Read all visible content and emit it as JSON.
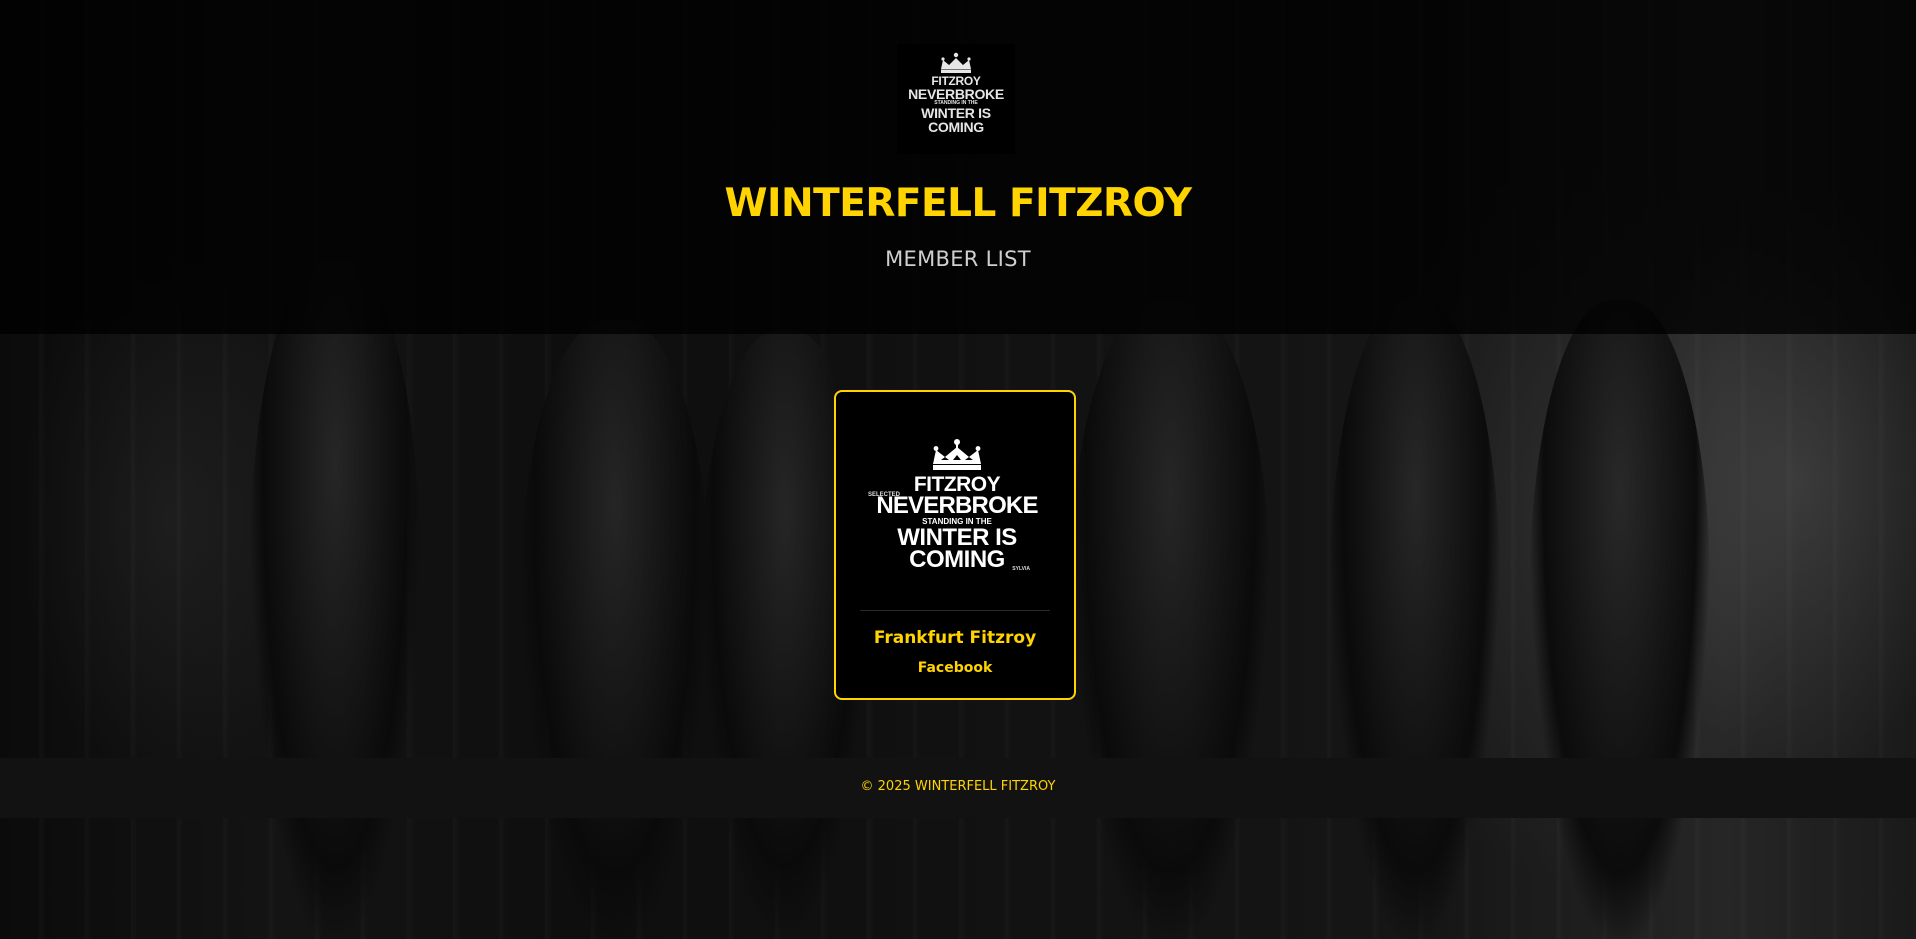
{
  "header": {
    "logo": {
      "lines": [
        "FITZROY",
        "NEVERBROKE",
        "STANDING IN THE",
        "WINTER IS",
        "COMING"
      ]
    },
    "title": "WINTERFELL FITZROY",
    "subtitle": "MEMBER LIST"
  },
  "members": [
    {
      "logo": {
        "side_left": "SELECTED",
        "lines": [
          "FITZROY",
          "NEVERBROKE",
          "STANDING IN THE",
          "WINTER IS",
          "COMING"
        ],
        "side_right": "SYLVIA"
      },
      "name": "Frankfurt Fitzroy",
      "link_label": "Facebook"
    }
  ],
  "footer": {
    "copyright": "© 2025 WINTERFELL FITZROY"
  },
  "colors": {
    "accent": "#ffd400",
    "header_bg": "#000000",
    "footer_bg": "#121212",
    "card_bg": "#000000"
  },
  "icons": {
    "logo_crown": "crown-icon"
  }
}
